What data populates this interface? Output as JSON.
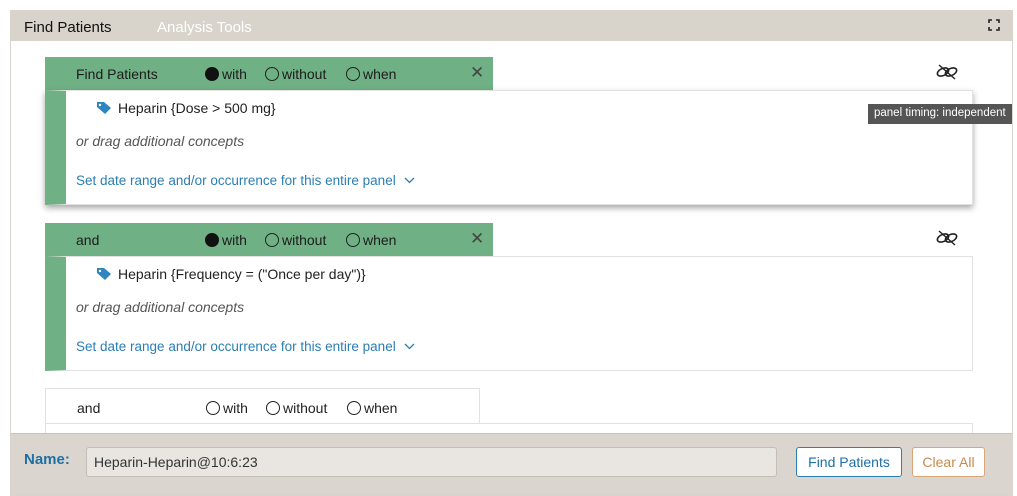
{
  "tabs": {
    "find_patients": "Find Patients",
    "analysis_tools": "Analysis Tools"
  },
  "panels": [
    {
      "label": "Find Patients",
      "options": {
        "with": "with",
        "without": "without",
        "when": "when"
      },
      "selected": "with",
      "concept": "Heparin {Dose > 500 mg}",
      "drag_hint": "or drag additional concepts",
      "date_link": "Set date range and/or occurrence for this entire panel"
    },
    {
      "label": "and",
      "options": {
        "with": "with",
        "without": "without",
        "when": "when"
      },
      "selected": "with",
      "concept": "Heparin {Frequency = (\"Once per day\")}",
      "drag_hint": "or drag additional concepts",
      "date_link": "Set date range and/or occurrence for this entire panel"
    },
    {
      "label": "and",
      "options": {
        "with": "with",
        "without": "without",
        "when": "when"
      },
      "selected": ""
    }
  ],
  "tooltip": "panel timing: independent",
  "footer": {
    "name_label": "Name:",
    "name_value": "Heparin-Heparin@10:6:23",
    "find_button": "Find Patients",
    "clear_button": "Clear All"
  },
  "icons": {
    "expand": "expand-icon",
    "unlink": "unlink-icon",
    "tag": "tag-icon",
    "close": "close-icon",
    "chevron": "chevron-down-icon"
  },
  "colors": {
    "panel_green": "#6fb084",
    "link_blue": "#2b7fb3",
    "tag_blue": "#2e86c1",
    "clear_orange": "#c98a4e",
    "topbar": "#d8d3cb"
  }
}
